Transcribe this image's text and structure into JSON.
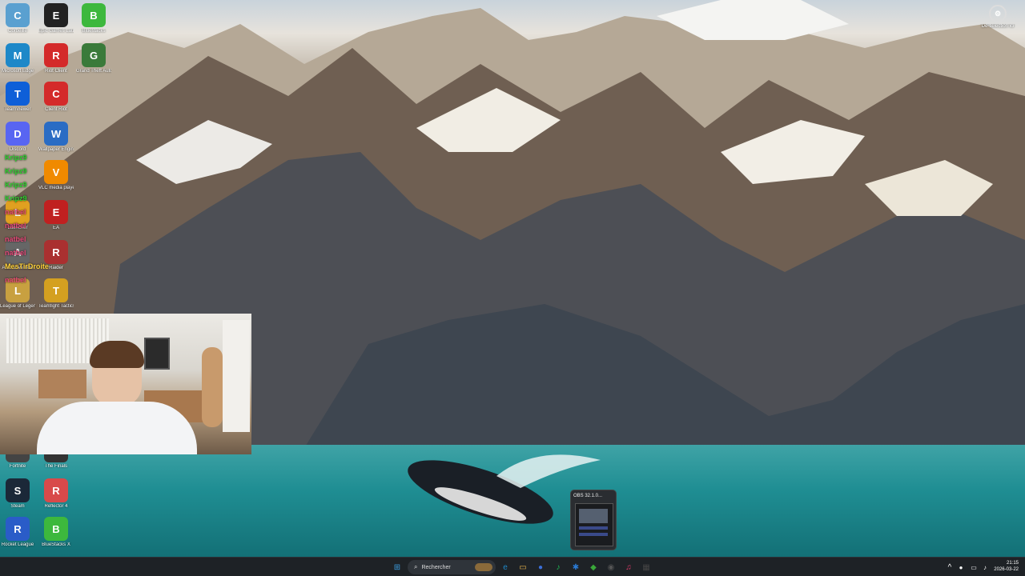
{
  "desktop": {
    "left_icons": [
      {
        "label": "Corbeille",
        "icon": "recycle-bin-icon",
        "color": "#5aa0d0"
      },
      {
        "label": "Epic Games Launcher",
        "icon": "epic-games-icon",
        "color": "#222222"
      },
      {
        "label": "Bluestacks",
        "icon": "bluestacks-icon",
        "color": "#3db83d"
      },
      {
        "label": "Microsoft Edge",
        "icon": "edge-icon",
        "color": "#1e88c8"
      },
      {
        "label": "Riot Client",
        "icon": "riot-icon",
        "color": "#d42a2a"
      },
      {
        "label": "Grand Theft Auto V",
        "icon": "gta-icon",
        "color": "#3a7a3a"
      },
      {
        "label": "TeamViewer",
        "icon": "teamviewer-icon",
        "color": "#0e5fd8"
      },
      {
        "label": "Client Riot",
        "icon": "riot-client-icon",
        "color": "#d42a2a"
      },
      {
        "label": "Discord",
        "icon": "discord-icon",
        "color": "#5865f2"
      },
      {
        "label": "Wallpaper Engine",
        "icon": "wallpaper-engine-icon",
        "color": "#2a6cc4"
      },
      {
        "label": "VLC media player",
        "icon": "vlc-icon",
        "color": "#f08a00"
      },
      {
        "label": "Launcher",
        "icon": "launcher-icon",
        "color": "#e0a020"
      },
      {
        "label": "EA",
        "icon": "ea-icon",
        "color": "#c02020"
      },
      {
        "label": "Auto V Vehicle",
        "icon": "auto-icon",
        "color": "#666666"
      },
      {
        "label": "Raider",
        "icon": "raider-icon",
        "color": "#aa3030"
      },
      {
        "label": "League of Legends",
        "icon": "league-icon",
        "color": "#c8a040"
      },
      {
        "label": "Teamfight Tactics",
        "icon": "tft-icon",
        "color": "#d4a020"
      },
      {
        "label": "Fortnite",
        "icon": "fortnite-icon",
        "color": "#444444"
      },
      {
        "label": "The Finals",
        "icon": "finals-icon",
        "color": "#333333"
      },
      {
        "label": "Steam",
        "icon": "steam-icon",
        "color": "#1b2838"
      },
      {
        "label": "Reflector 4",
        "icon": "reflector-icon",
        "color": "#d84a4a"
      },
      {
        "label": "Rocket League",
        "icon": "rocket-league-icon",
        "color": "#2a5cc8"
      },
      {
        "label": "BlueStacks X",
        "icon": "bluestacks-x-icon",
        "color": "#3db83d"
      }
    ],
    "overlay_tags": [
      "Kripz9",
      "Kripz9",
      "Kripz9",
      "Kripz9",
      "natbel",
      "natbel",
      "natbel",
      "natbel",
      "MesTirDroite",
      "natbel"
    ],
    "top_right_icon": {
      "label": "Dé-sélection ici",
      "icon": "settings-gear-icon"
    }
  },
  "obs_thumbnail": {
    "title": "OBS 32.1.0..."
  },
  "taskbar": {
    "search_placeholder": "Rechercher",
    "apps": [
      {
        "name": "start-button",
        "glyph": "⊞",
        "color": "#3a9bdc"
      },
      {
        "name": "edge-taskbar",
        "glyph": "e",
        "color": "#1e88c8"
      },
      {
        "name": "file-explorer-taskbar",
        "glyph": "▭",
        "color": "#e5b24a"
      },
      {
        "name": "chrome-taskbar",
        "glyph": "●",
        "color": "#3b6fd8"
      },
      {
        "name": "spotify-taskbar",
        "glyph": "♪",
        "color": "#1db954"
      },
      {
        "name": "ps-taskbar",
        "glyph": "✱",
        "color": "#2a7ad4"
      },
      {
        "name": "apps-taskbar",
        "glyph": "◆",
        "color": "#3aa83a"
      },
      {
        "name": "obs-taskbar",
        "glyph": "◉",
        "color": "#555555"
      },
      {
        "name": "media-taskbar",
        "glyph": "♫",
        "color": "#e23b6b"
      },
      {
        "name": "misc-taskbar",
        "glyph": "▦",
        "color": "#444444"
      }
    ],
    "clock_time": "21:15",
    "clock_date": "2026-03-22"
  }
}
